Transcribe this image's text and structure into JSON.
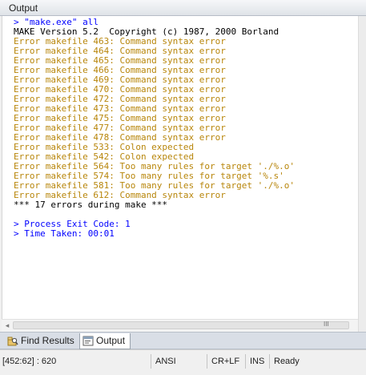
{
  "panel": {
    "title": "Output"
  },
  "output": {
    "lines": [
      {
        "text": "> \"make.exe\" all",
        "kind": "blue"
      },
      {
        "text": "MAKE Version 5.2  Copyright (c) 1987, 2000 Borland",
        "kind": "black"
      },
      {
        "text": "Error makefile 463: Command syntax error",
        "kind": "err"
      },
      {
        "text": "Error makefile 464: Command syntax error",
        "kind": "err"
      },
      {
        "text": "Error makefile 465: Command syntax error",
        "kind": "err"
      },
      {
        "text": "Error makefile 466: Command syntax error",
        "kind": "err"
      },
      {
        "text": "Error makefile 469: Command syntax error",
        "kind": "err"
      },
      {
        "text": "Error makefile 470: Command syntax error",
        "kind": "err"
      },
      {
        "text": "Error makefile 472: Command syntax error",
        "kind": "err"
      },
      {
        "text": "Error makefile 473: Command syntax error",
        "kind": "err"
      },
      {
        "text": "Error makefile 475: Command syntax error",
        "kind": "err"
      },
      {
        "text": "Error makefile 477: Command syntax error",
        "kind": "err"
      },
      {
        "text": "Error makefile 478: Command syntax error",
        "kind": "err"
      },
      {
        "text": "Error makefile 533: Colon expected",
        "kind": "err"
      },
      {
        "text": "Error makefile 542: Colon expected",
        "kind": "err"
      },
      {
        "text": "Error makefile 564: Too many rules for target './%.o'",
        "kind": "err"
      },
      {
        "text": "Error makefile 574: Too many rules for target '%.s'",
        "kind": "err"
      },
      {
        "text": "Error makefile 581: Too many rules for target './%.o'",
        "kind": "err"
      },
      {
        "text": "Error makefile 612: Command syntax error",
        "kind": "err"
      },
      {
        "text": "*** 17 errors during make ***",
        "kind": "black"
      },
      {
        "text": "",
        "kind": "black"
      },
      {
        "text": "> Process Exit Code: 1",
        "kind": "blue"
      },
      {
        "text": "> Time Taken: 00:01",
        "kind": "blue"
      }
    ]
  },
  "scrollbar": {
    "left_arrow_icon": "left-arrow",
    "grip_glyph": "III"
  },
  "tabs": [
    {
      "label": "Find Results",
      "icon": "find-results-icon",
      "active": false
    },
    {
      "label": "Output",
      "icon": "output-icon",
      "active": true
    }
  ],
  "status": {
    "position": "[452:62] : 620",
    "encoding": "ANSI",
    "line_ending": "CR+LF",
    "insert_mode": "INS",
    "state": "Ready"
  },
  "colors": {
    "blue_text": "#0000ff",
    "error_text": "#b8860b",
    "black_text": "#000000"
  }
}
